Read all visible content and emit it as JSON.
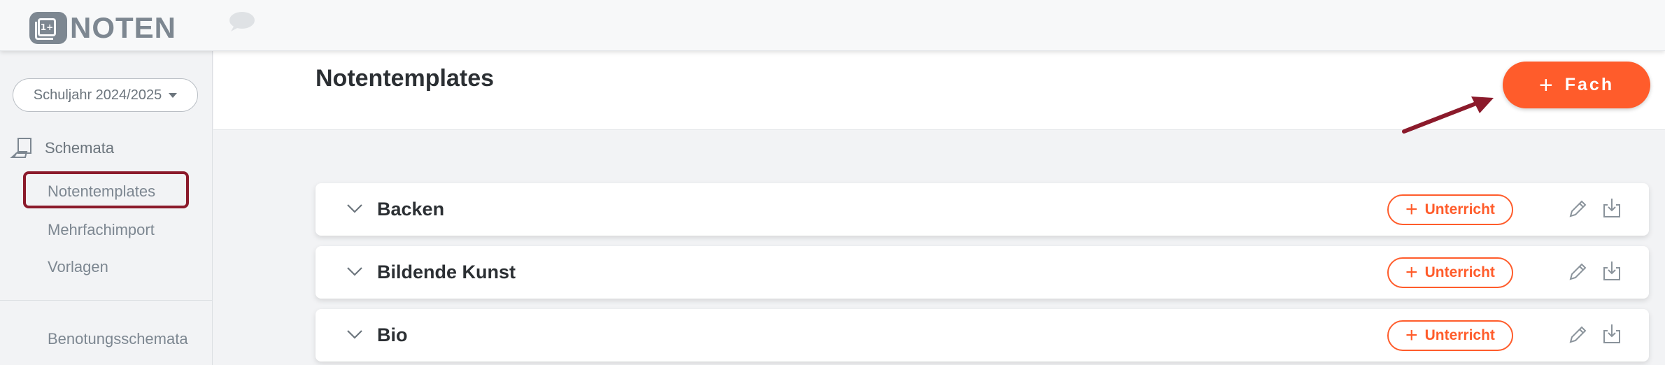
{
  "app": {
    "logo_text": "NOTEN",
    "logo_badge": "1+"
  },
  "sidebar": {
    "year_select": "Schuljahr 2024/2025",
    "section_label": "Schemata",
    "items": [
      {
        "label": "Notentemplates"
      },
      {
        "label": "Mehrfachimport"
      },
      {
        "label": "Vorlagen"
      },
      {
        "label": "Benotungsschemata"
      }
    ]
  },
  "main": {
    "title": "Notentemplates",
    "add_button_plus": "+",
    "add_button_label": "Fach",
    "subjects": [
      {
        "name": "Backen",
        "button_label": "Unterricht"
      },
      {
        "name": "Bildende Kunst",
        "button_label": "Unterricht"
      },
      {
        "name": "Bio",
        "button_label": "Unterricht"
      }
    ]
  },
  "colors": {
    "accent": "#ff5c2b",
    "highlight": "#8b1a2b",
    "muted": "#7d8791"
  },
  "icons": [
    "chat-icon",
    "schemata-icon",
    "chevron-down-icon",
    "pencil-icon",
    "export-icon",
    "caret-down-icon"
  ]
}
